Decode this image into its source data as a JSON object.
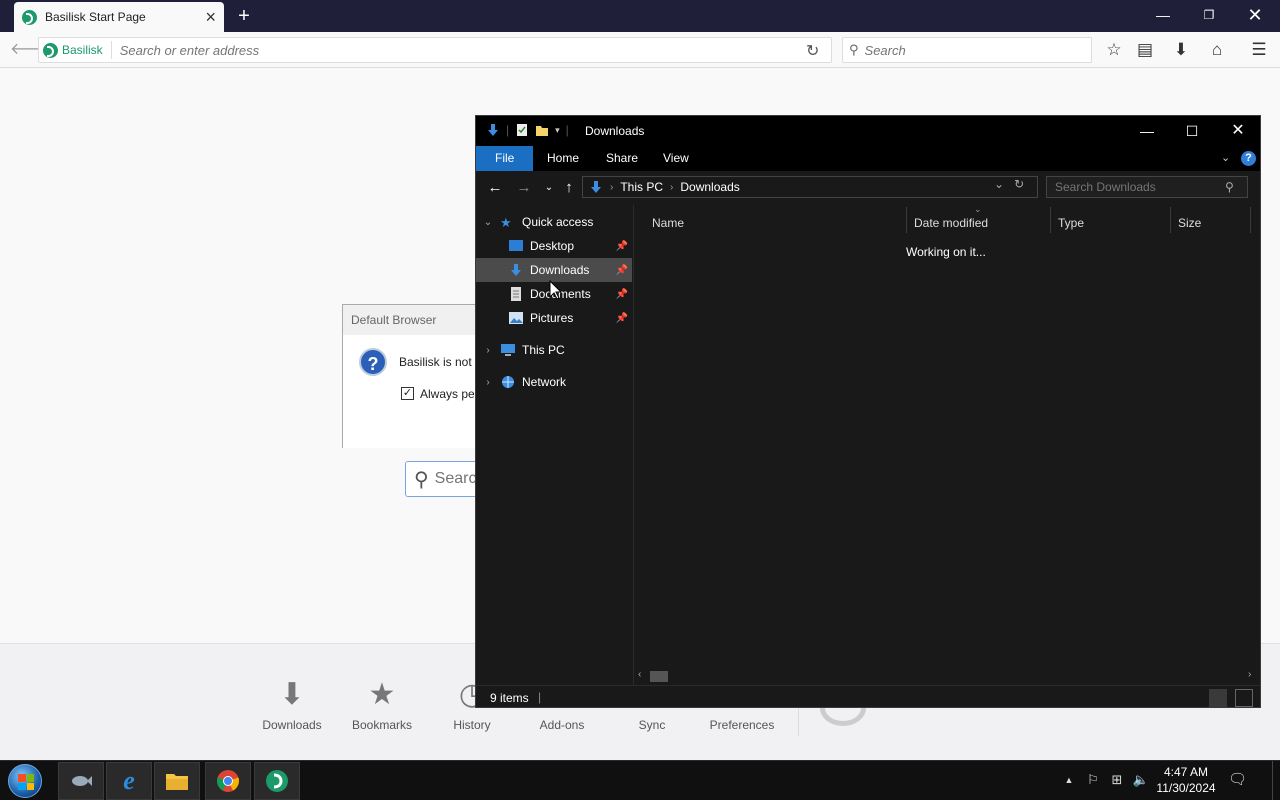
{
  "browser": {
    "tab_title": "Basilisk Start Page",
    "identity_label": "Basilisk",
    "url_placeholder": "Search or enter address",
    "search_placeholder": "Search",
    "brand_color": "#1c9a6a"
  },
  "start_page": {
    "search_placeholder": "Search",
    "launcher": [
      {
        "label": "Downloads",
        "icon": "download-arrow-icon"
      },
      {
        "label": "Bookmarks",
        "icon": "star-icon"
      },
      {
        "label": "History",
        "icon": "clock-icon"
      },
      {
        "label": "Add-ons",
        "icon": "puzzle-icon"
      },
      {
        "label": "Sync",
        "icon": "sync-icon"
      },
      {
        "label": "Preferences",
        "icon": "gear-icon"
      }
    ]
  },
  "dialog": {
    "title": "Default Browser",
    "message": "Basilisk is not c",
    "checkbox_label": "Always per",
    "checked": true
  },
  "explorer": {
    "title": "Downloads",
    "ribbon_tabs": [
      "File",
      "Home",
      "Share",
      "View"
    ],
    "breadcrumb": [
      "This PC",
      "Downloads"
    ],
    "search_placeholder": "Search Downloads",
    "nav": {
      "quick_access": "Quick access",
      "pinned": [
        "Desktop",
        "Downloads",
        "Documents",
        "Pictures"
      ],
      "this_pc": "This PC",
      "network": "Network"
    },
    "columns": [
      "Name",
      "Date modified",
      "Type",
      "Size"
    ],
    "status_message": "Working on it...",
    "item_count": "9 items",
    "accent_color": "#1a6fc2"
  },
  "taskbar": {
    "time": "4:47 AM",
    "date": "11/30/2024"
  }
}
